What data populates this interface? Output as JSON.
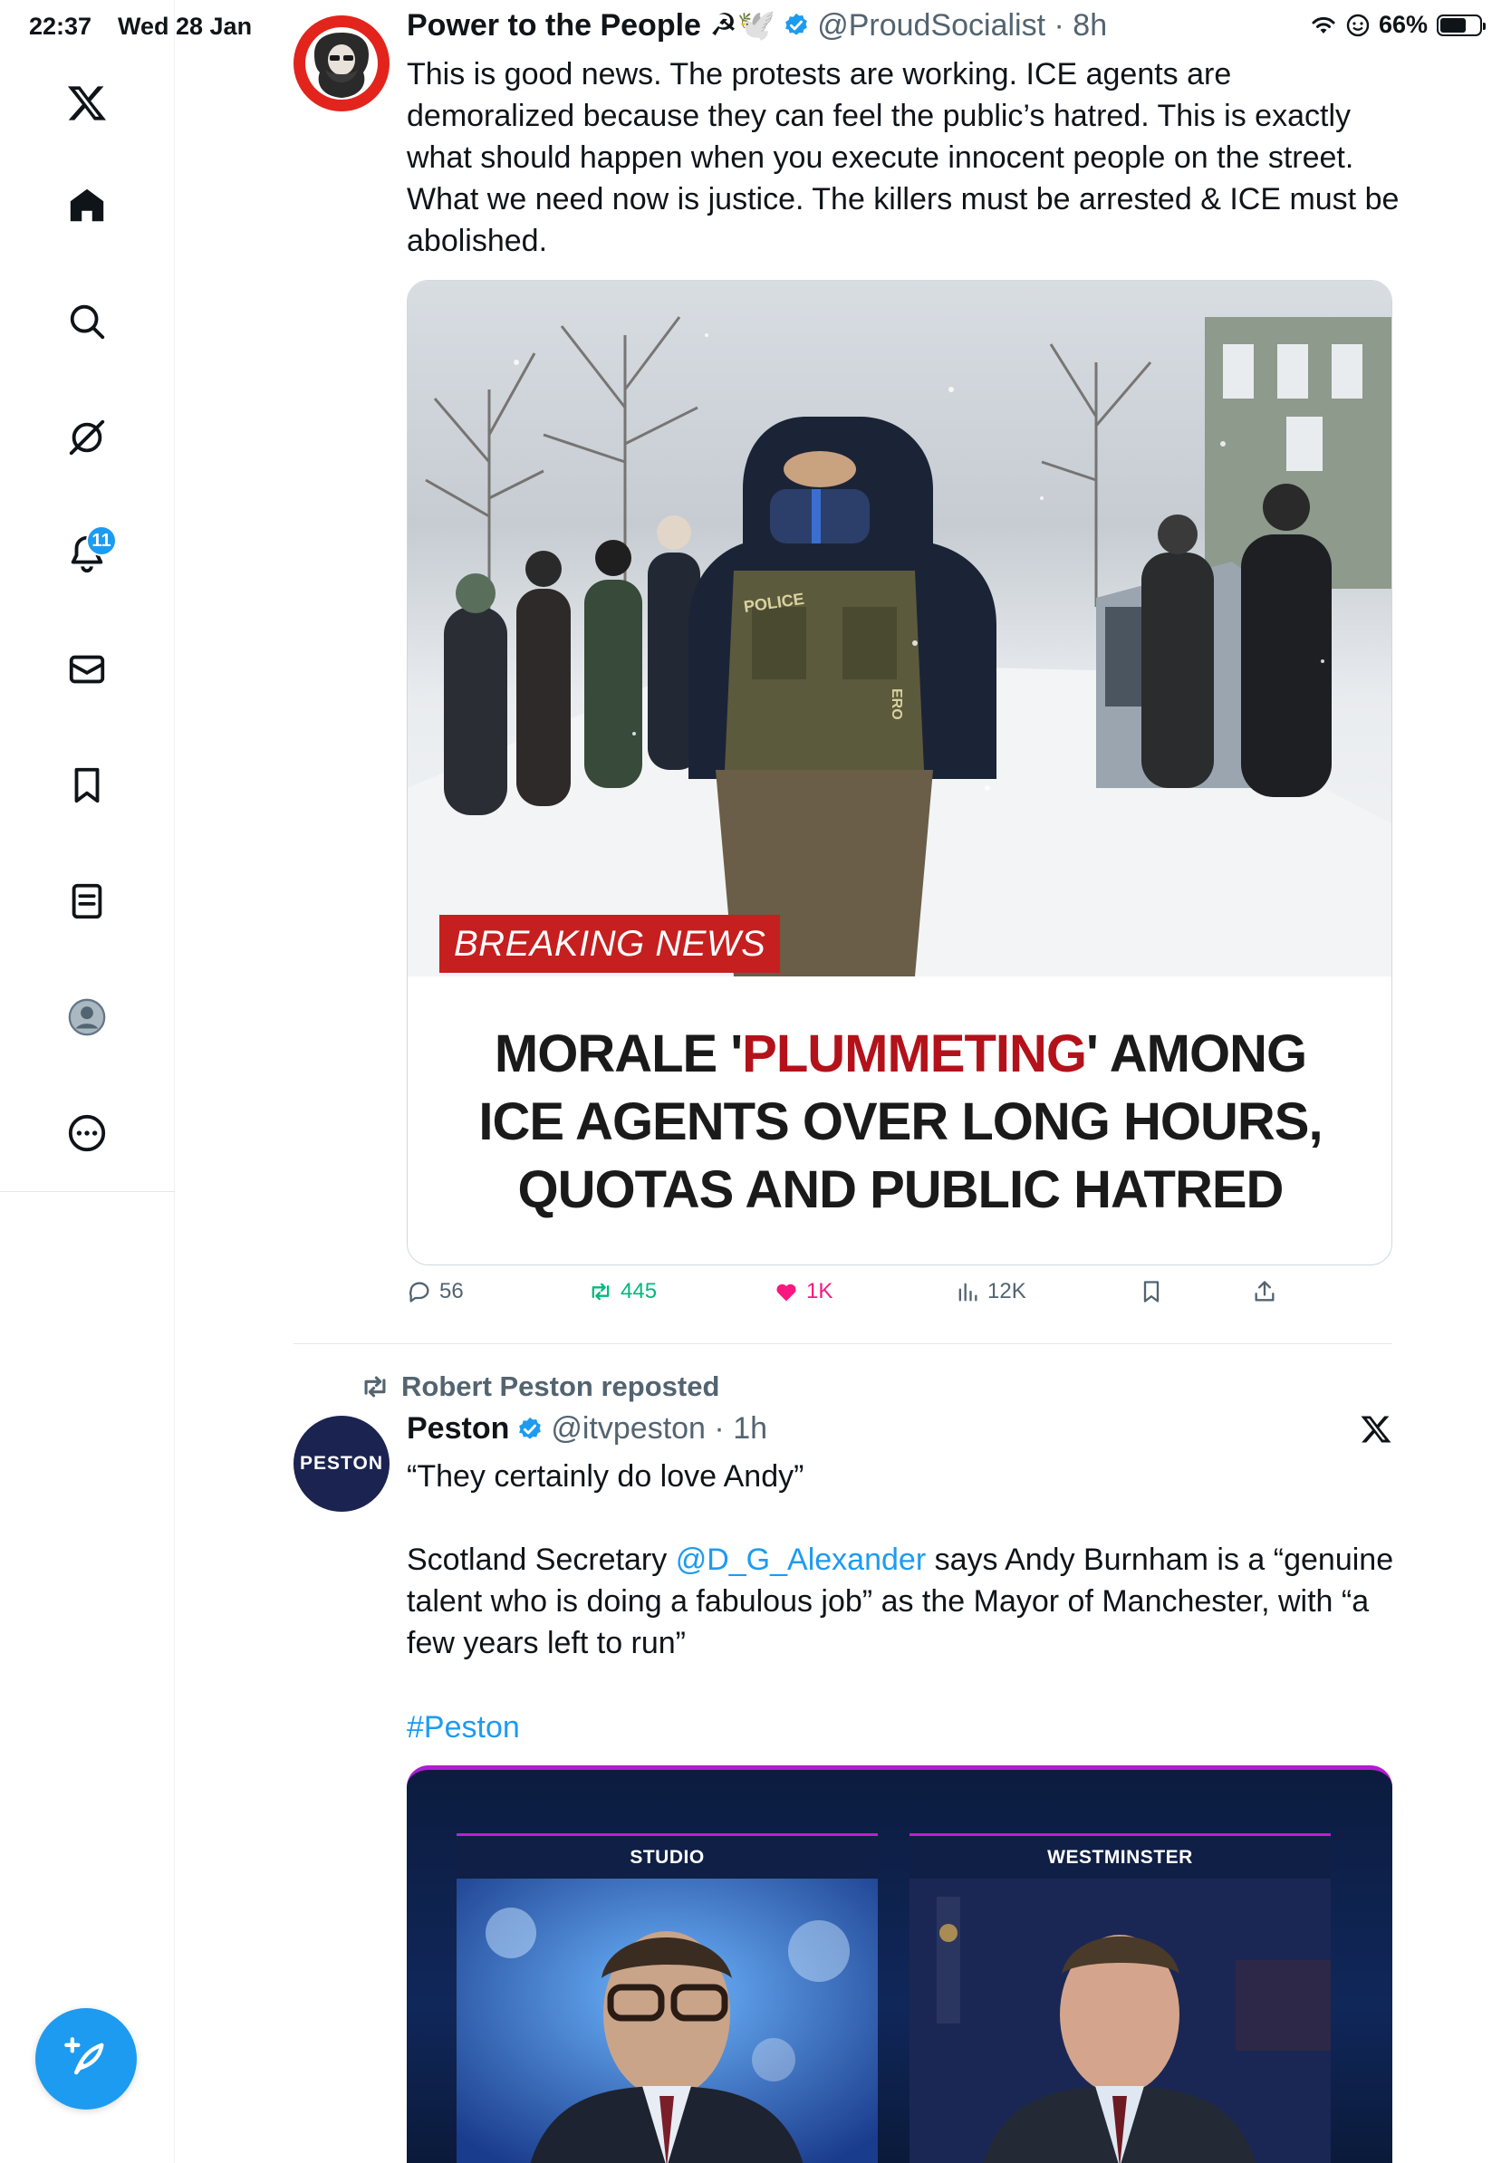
{
  "status_bar": {
    "time": "22:37",
    "date": "Wed 28 Jan",
    "battery": "66%",
    "battery_level": 0.66
  },
  "sidebar": {
    "items": [
      {
        "name": "x-logo",
        "icon": "x-logo-icon"
      },
      {
        "name": "home",
        "icon": "home-icon"
      },
      {
        "name": "search",
        "icon": "search-icon"
      },
      {
        "name": "grok",
        "icon": "grok-icon"
      },
      {
        "name": "notifications",
        "icon": "bell-icon",
        "badge": "11"
      },
      {
        "name": "messages",
        "icon": "mail-icon"
      },
      {
        "name": "bookmarks",
        "icon": "bookmark-icon"
      },
      {
        "name": "lists",
        "icon": "list-icon"
      },
      {
        "name": "profile",
        "icon": "profile-icon"
      },
      {
        "name": "more",
        "icon": "more-icon"
      }
    ],
    "compose_icon": "compose-feather-icon"
  },
  "tweet1": {
    "name": "Power to the People ☭🕊️",
    "handle": "@ProudSocialist",
    "time": "8h",
    "body": "This is good news. The protests are working. ICE agents are demoralized because they can feel the public’s hatred. This is exactly what should happen when you execute innocent people on the street. What we need now is justice. The killers must be arrested & ICE must be abolished.",
    "media": {
      "banner": "BREAKING NEWS",
      "vest_patch": "POLICE",
      "vest_tag": "ERO",
      "headline_part1": "MORALE '",
      "headline_red": "PLUMMETING",
      "headline_part2": "' AMONG",
      "headline_line2": "ICE AGENTS OVER LONG HOURS,",
      "headline_line3": "QUOTAS AND PUBLIC HATRED"
    },
    "actions": {
      "replies": "56",
      "reposts": "445",
      "likes": "1K",
      "views": "12K"
    }
  },
  "tweet2": {
    "repost_label": "Robert Peston reposted",
    "name": "Peston",
    "handle": "@itvpeston",
    "time": "1h",
    "avatar_text": "PESTON",
    "quote": "“They certainly do love Andy”",
    "body_pre": "Scotland Secretary ",
    "mention": "@D_G_Alexander",
    "body_post": " says Andy Burnham is a “genuine talent who is doing a fabulous job” as the Mayor of Manchester, with “a few years left to run”",
    "hashtag": "#Peston",
    "media": {
      "left_label": "STUDIO",
      "right_label": "WESTMINSTER"
    }
  },
  "colors": {
    "accent": "#1d9bf0",
    "repost": "#00ba7c",
    "like": "#f91880",
    "breaking": "#c61f1f",
    "headline_red": "#b3121a"
  }
}
